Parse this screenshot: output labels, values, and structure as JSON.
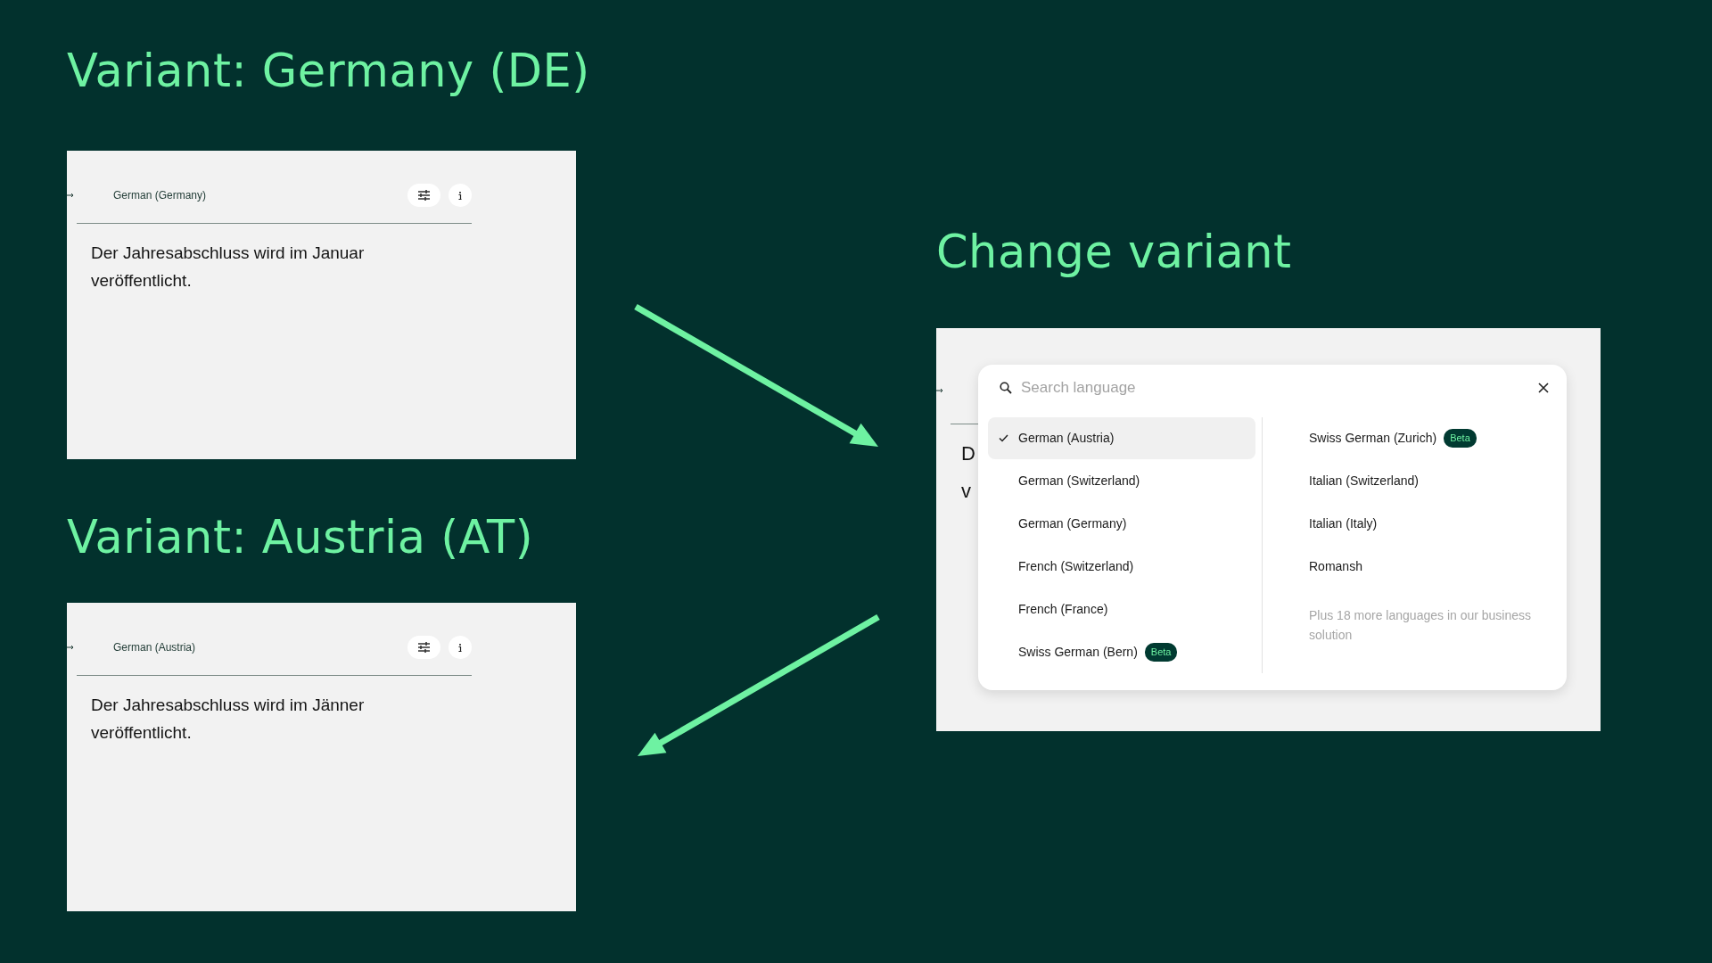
{
  "variants": [
    {
      "title": "Variant: Germany (DE)",
      "panel": {
        "language": "German (Germany)",
        "text": "Der Jahresabschluss wird im Januar veröffentlicht."
      }
    },
    {
      "title": "Variant: Austria (AT)",
      "panel": {
        "language": "German (Austria)",
        "text": "Der Jahresabschluss wird im Jänner veröffentlicht."
      }
    }
  ],
  "change": {
    "title": "Change variant",
    "background_letters": [
      "D",
      "v"
    ],
    "dialog": {
      "search": {
        "placeholder": "Search language"
      },
      "columns": [
        [
          {
            "label": "German (Austria)",
            "selected": true
          },
          {
            "label": "German (Switzerland)",
            "selected": false
          },
          {
            "label": "German (Germany)",
            "selected": false
          },
          {
            "label": "French (Switzerland)",
            "selected": false
          },
          {
            "label": "French (France)",
            "selected": false
          },
          {
            "label": "Swiss German (Bern)",
            "selected": false,
            "badge": "Beta"
          }
        ],
        [
          {
            "label": "Swiss German (Zurich)",
            "selected": false,
            "badge": "Beta"
          },
          {
            "label": "Italian (Switzerland)",
            "selected": false
          },
          {
            "label": "Italian (Italy)",
            "selected": false
          },
          {
            "label": "Romansh",
            "selected": false
          }
        ]
      ],
      "note": "Plus 18 more languages in our business solution"
    }
  }
}
